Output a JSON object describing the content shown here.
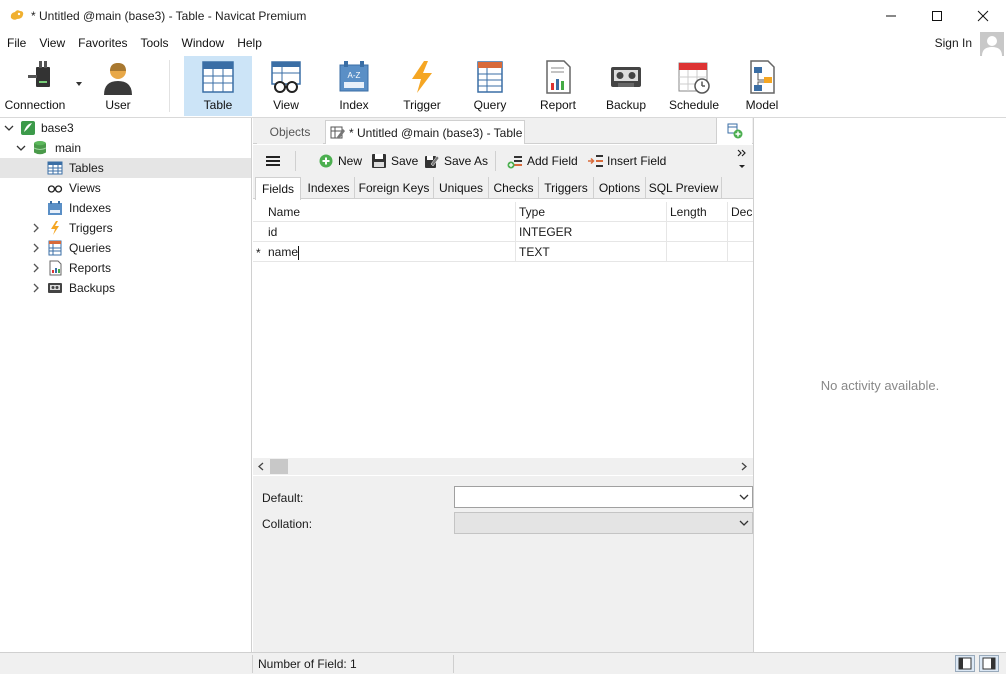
{
  "window": {
    "title": "* Untitled @main (base3) - Table - Navicat Premium"
  },
  "menu": {
    "items": [
      "File",
      "View",
      "Favorites",
      "Tools",
      "Window",
      "Help"
    ],
    "sign_in": "Sign In"
  },
  "toolbar": {
    "items": [
      {
        "label": "Connection",
        "icon": "connection-icon"
      },
      {
        "label": "User",
        "icon": "user-icon"
      },
      {
        "label": "Table",
        "icon": "table-icon",
        "active": true
      },
      {
        "label": "View",
        "icon": "view-icon"
      },
      {
        "label": "Index",
        "icon": "index-icon"
      },
      {
        "label": "Trigger",
        "icon": "trigger-icon"
      },
      {
        "label": "Query",
        "icon": "query-icon"
      },
      {
        "label": "Report",
        "icon": "report-icon"
      },
      {
        "label": "Backup",
        "icon": "backup-icon"
      },
      {
        "label": "Schedule",
        "icon": "schedule-icon"
      },
      {
        "label": "Model",
        "icon": "model-icon"
      }
    ]
  },
  "tree": {
    "connection": "base3",
    "database": "main",
    "nodes": [
      "Tables",
      "Views",
      "Indexes",
      "Triggers",
      "Queries",
      "Reports",
      "Backups"
    ],
    "selected": "Tables"
  },
  "tabs": {
    "objects": "Objects",
    "active": "* Untitled @main (base3) - Table"
  },
  "editor_toolbar": {
    "new": "New",
    "save": "Save",
    "save_as": "Save As",
    "add_field": "Add Field",
    "insert_field": "Insert Field"
  },
  "subtabs": [
    "Fields",
    "Indexes",
    "Foreign Keys",
    "Uniques",
    "Checks",
    "Triggers",
    "Options",
    "SQL Preview"
  ],
  "grid": {
    "columns": [
      "Name",
      "Type",
      "Length",
      "Dec"
    ],
    "rows": [
      {
        "marker": "",
        "name": "id",
        "type": "INTEGER",
        "length": "",
        "dec": ""
      },
      {
        "marker": "*",
        "name": "name",
        "type": "TEXT",
        "length": "",
        "dec": ""
      }
    ]
  },
  "properties": {
    "default_label": "Default:",
    "collation_label": "Collation:",
    "default_value": "",
    "collation_value": ""
  },
  "right_panel": {
    "message": "No activity available."
  },
  "status": {
    "text": "Number of Field: 1"
  },
  "colors": {
    "accent": "#cce4f7",
    "panel_bg": "#f0f0f0",
    "selected_row": "#e5e5e5",
    "trigger": "#f5a623"
  }
}
